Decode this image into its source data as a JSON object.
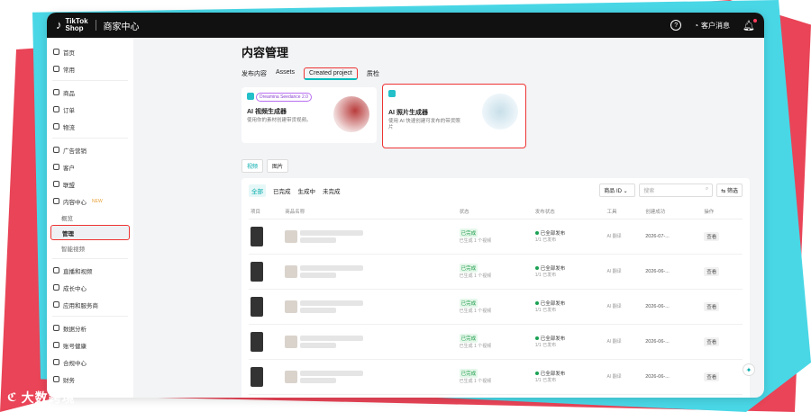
{
  "colors": {
    "accent": "#00a9b0",
    "highlight": "#e33333",
    "topbar": "#111111"
  },
  "topbar": {
    "logo_line1": "TikTok",
    "logo_line2": "Shop",
    "title": "商家中心",
    "help_icon": "question-circle-icon",
    "messages_label": "客户消息",
    "bell_icon": "bell-icon"
  },
  "sidebar": {
    "items": [
      {
        "label": "首页",
        "icon": "home-icon"
      },
      {
        "label": "常用",
        "icon": "star-icon"
      },
      {
        "label": "商品",
        "icon": "box-icon"
      },
      {
        "label": "订单",
        "icon": "order-icon"
      },
      {
        "label": "物流",
        "icon": "truck-icon"
      },
      {
        "label": "广告营销",
        "icon": "megaphone-icon"
      },
      {
        "label": "客户",
        "icon": "user-icon"
      },
      {
        "label": "联盟",
        "icon": "link-icon"
      },
      {
        "label": "内容中心",
        "icon": "content-icon",
        "badge": "NEW"
      },
      {
        "label": "概览",
        "sub": true
      },
      {
        "label": "管理",
        "sub": true,
        "active": true
      },
      {
        "label": "智能视频",
        "sub": true
      },
      {
        "label": "直播和视频",
        "icon": "video-icon"
      },
      {
        "label": "成长中心",
        "icon": "growth-icon"
      },
      {
        "label": "应用和服务商",
        "icon": "apps-icon"
      },
      {
        "label": "数据分析",
        "icon": "chart-icon"
      },
      {
        "label": "账号健康",
        "icon": "shield-icon"
      },
      {
        "label": "合规中心",
        "icon": "compliance-icon"
      },
      {
        "label": "财务",
        "icon": "finance-icon"
      }
    ]
  },
  "main": {
    "title": "内容管理",
    "tabs": [
      "发布内容",
      "Assets",
      "Created project",
      "质检"
    ],
    "cards": [
      {
        "badge": "Dreamina Seedance 2.0",
        "title": "AI 视频生成器",
        "desc": "使用你的素材创建带货视频。"
      },
      {
        "title": "AI 照片生成器",
        "desc": "使用 AI 快速创建可发布的带货照片"
      }
    ],
    "sub_tabs": [
      "视频",
      "图片"
    ],
    "filters": [
      "全部",
      "已完成",
      "生成中",
      "未完成"
    ],
    "select_label": "商品 ID",
    "search_placeholder": "搜索",
    "filter_button": "筛选",
    "columns": [
      "项目",
      "商品名称",
      "状态",
      "发布状态",
      "工具",
      "创建成功",
      "操作"
    ],
    "rows": [
      {
        "status": "已完成",
        "status_sub": "已生成 1 个视频",
        "pub": "已全部发布",
        "pub_sub": "1/1 已发布",
        "tool": "AI 翻译",
        "date": "2026-07-...",
        "action": "查看"
      },
      {
        "status": "已完成",
        "status_sub": "已生成 1 个视频",
        "pub": "已全部发布",
        "pub_sub": "1/1 已发布",
        "tool": "AI 翻译",
        "date": "2026-06-...",
        "action": "查看"
      },
      {
        "status": "已完成",
        "status_sub": "已生成 1 个视频",
        "pub": "已全部发布",
        "pub_sub": "1/1 已发布",
        "tool": "AI 翻译",
        "date": "2026-06-...",
        "action": "查看"
      },
      {
        "status": "已完成",
        "status_sub": "已生成 1 个视频",
        "pub": "已全部发布",
        "pub_sub": "1/1 已发布",
        "tool": "AI 翻译",
        "date": "2026-06-...",
        "action": "查看"
      },
      {
        "status": "已完成",
        "status_sub": "已生成 1 个视频",
        "pub": "已全部发布",
        "pub_sub": "1/1 已发布",
        "tool": "AI 翻译",
        "date": "2026-06-...",
        "action": "查看"
      }
    ]
  },
  "watermark": "大数跨境"
}
